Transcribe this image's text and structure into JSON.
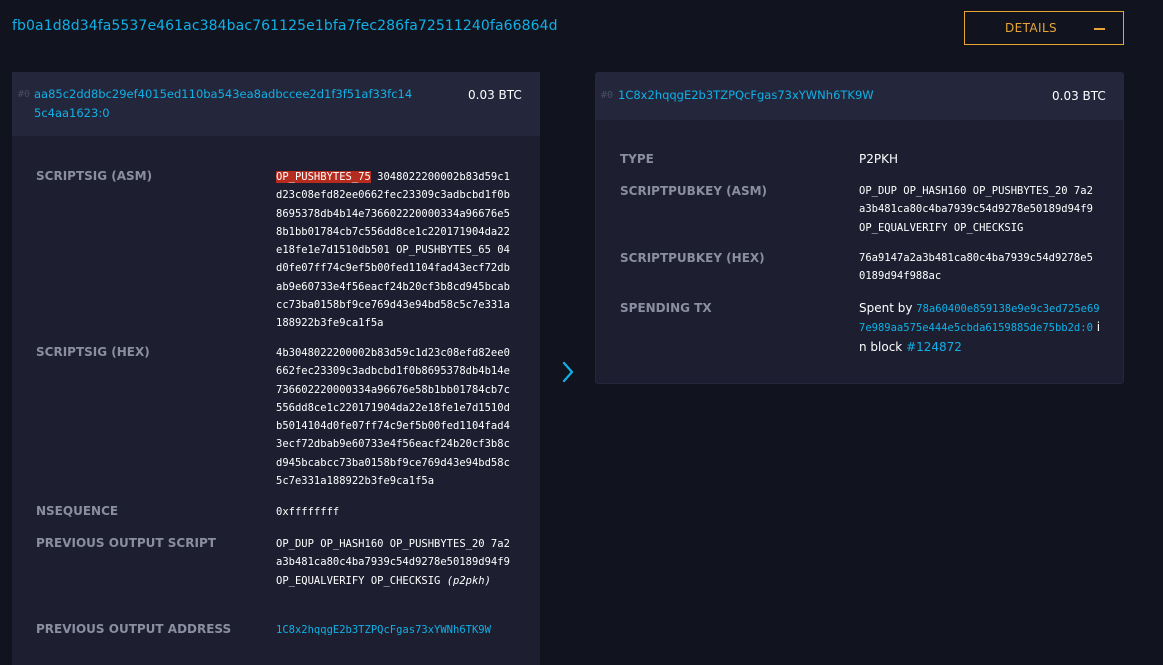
{
  "transaction": {
    "txid": "fb0a1d8d34fa5537e461ac384bac761125e1bfa7fec286fa72511240fa66864d",
    "details_label": "DETAILS"
  },
  "input": {
    "index": "#0",
    "prev_txid_vout": "aa85c2dd8bc29ef4015ed110ba543ea8adbccee2d1f3f51af33fc145c4aa1623:0",
    "amount": "0.03 BTC",
    "fields": {
      "scriptsig_asm_label": "SCRIPTSIG (ASM)",
      "scriptsig_asm_highlight": "OP_PUSHBYTES_75",
      "scriptsig_asm_rest": " 3048022200002b83d59c1d23c08efd82ee0662fec23309c3adbcbd1f0b8695378db4b14e736602220000334a96676e58b1bb01784cb7c556dd8ce1c220171904da22e18fe1e7d1510db501 OP_PUSHBYTES_65 04d0fe07ff74c9ef5b00fed1104fad43ecf72dbab9e60733e4f56eacf24b20cf3b8cd945bcabcc73ba0158bf9ce769d43e94bd58c5c7e331a188922b3fe9ca1f5a",
      "scriptsig_hex_label": "SCRIPTSIG (HEX)",
      "scriptsig_hex": "4b3048022200002b83d59c1d23c08efd82ee0662fec23309c3adbcbd1f0b8695378db4b14e736602220000334a96676e58b1bb01784cb7c556dd8ce1c220171904da22e18fe1e7d1510db5014104d0fe07ff74c9ef5b00fed1104fad43ecf72dbab9e60733e4f56eacf24b20cf3b8cd945bcabcc73ba0158bf9ce769d43e94bd58c5c7e331a188922b3fe9ca1f5a",
      "nsequence_label": "NSEQUENCE",
      "nsequence": "0xffffffff",
      "prev_script_label": "PREVIOUS OUTPUT SCRIPT",
      "prev_script": "OP_DUP OP_HASH160 OP_PUSHBYTES_20 7a2a3b481ca80c4ba7939c54d9278e50189d94f9 OP_EQUALVERIFY OP_CHECKSIG",
      "prev_script_type": "(p2pkh)",
      "prev_address_label": "PREVIOUS OUTPUT ADDRESS",
      "prev_address": "1C8x2hqqgE2b3TZPQcFgas73xYWNh6TK9W"
    }
  },
  "output": {
    "index": "#0",
    "address": "1C8x2hqqgE2b3TZPQcFgas73xYWNh6TK9W",
    "amount": "0.03 BTC",
    "fields": {
      "type_label": "TYPE",
      "type": "P2PKH",
      "spk_asm_label": "SCRIPTPUBKEY (ASM)",
      "spk_asm": "OP_DUP OP_HASH160 OP_PUSHBYTES_20 7a2a3b481ca80c4ba7939c54d9278e50189d94f9 OP_EQUALVERIFY OP_CHECKSIG",
      "spk_hex_label": "SCRIPTPUBKEY (HEX)",
      "spk_hex": "76a9147a2a3b481ca80c4ba7939c54d9278e50189d94f988ac",
      "spending_label": "SPENDING TX",
      "spent_by_text": "Spent by ",
      "spending_txid_vout": "78a60400e859138e9e9c3ed725e697e989aa575e444e5cbda6159885de75bb2d:0",
      "in_block_text": " in block ",
      "block": "#124872"
    }
  },
  "icons": {
    "flow_arrow": "chevron-right-icon",
    "collapse": "minus-icon"
  },
  "colors": {
    "background": "#11131f",
    "card": "#1d1f31",
    "card_header": "#24273b",
    "link": "#11b0e6",
    "accent": "#e7a636",
    "highlight": "#b52c1f",
    "label": "#8a8e9f"
  }
}
